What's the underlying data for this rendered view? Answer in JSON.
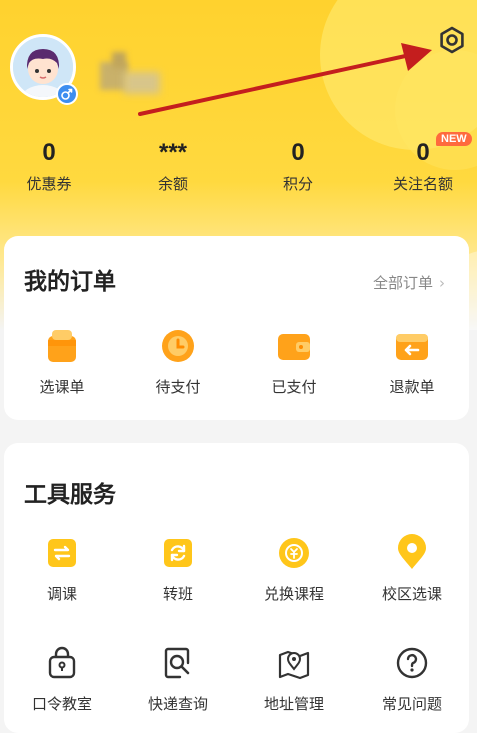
{
  "profile": {
    "avatar_icon": "avatar-boy-icon",
    "gender_icon": "male-icon"
  },
  "header": {
    "settings_icon": "gear-icon"
  },
  "stats": [
    {
      "value": "0",
      "label": "优惠券"
    },
    {
      "value": "***",
      "label": "余额"
    },
    {
      "value": "0",
      "label": "积分"
    },
    {
      "value": "0",
      "label": "关注名额",
      "badge": "NEW"
    }
  ],
  "orders": {
    "title": "我的订单",
    "view_all": "全部订单",
    "items": [
      {
        "label": "选课单",
        "icon": "shopping-bag-icon"
      },
      {
        "label": "待支付",
        "icon": "clock-icon"
      },
      {
        "label": "已支付",
        "icon": "wallet-icon"
      },
      {
        "label": "退款单",
        "icon": "refund-icon"
      }
    ]
  },
  "tools": {
    "title": "工具服务",
    "items": [
      {
        "label": "调课",
        "icon": "swap-icon"
      },
      {
        "label": "转班",
        "icon": "refresh-icon"
      },
      {
        "label": "兑换课程",
        "icon": "redeem-icon"
      },
      {
        "label": "校区选课",
        "icon": "location-pin-icon"
      },
      {
        "label": "口令教室",
        "icon": "lock-icon"
      },
      {
        "label": "快递查询",
        "icon": "search-package-icon"
      },
      {
        "label": "地址管理",
        "icon": "map-icon"
      },
      {
        "label": "常见问题",
        "icon": "question-icon"
      }
    ]
  },
  "colors": {
    "accent": "#ffd22e",
    "orange": "#ffa21a",
    "arrow": "#c41e1e",
    "badge": "#ff6a3d"
  }
}
